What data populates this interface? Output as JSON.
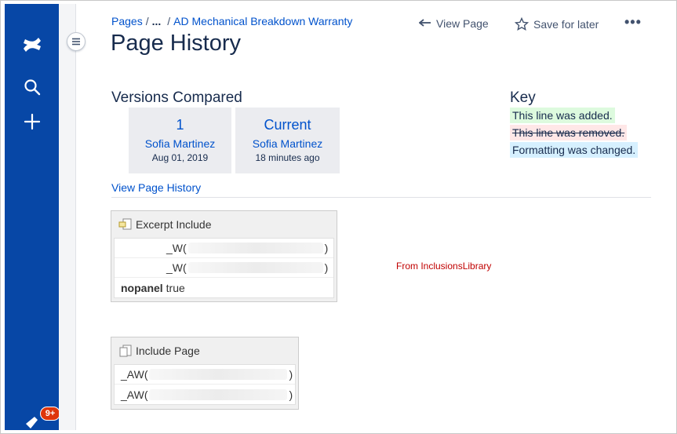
{
  "breadcrumb": {
    "pages": "Pages",
    "ellipsis": "...",
    "current": "AD Mechanical Breakdown Warranty"
  },
  "header": {
    "title": "Page History",
    "view_page": "View Page",
    "save_for_later": "Save for later",
    "more": "•••"
  },
  "sidebar": {
    "notification_badge": "9+"
  },
  "versions": {
    "heading": "Versions Compared",
    "left": {
      "number": "1",
      "author": "Sofia Martinez",
      "date": "Aug 01, 2019"
    },
    "right": {
      "number": "Current",
      "author": "Sofia Martinez",
      "date": "18 minutes ago"
    },
    "history_link": "View Page History"
  },
  "key": {
    "heading": "Key",
    "added": "This line was added.",
    "removed": "This line was removed.",
    "formatting": "Formatting was changed."
  },
  "excerpt_macro": {
    "title": "Excerpt Include",
    "rows": [
      {
        "prefix": "_W(",
        "suffix": ")"
      },
      {
        "prefix": "_W(",
        "suffix": ")"
      }
    ],
    "param_name": "nopanel",
    "param_value": "true"
  },
  "from_library": "From InclusionsLibrary",
  "include_macro": {
    "title": "Include Page",
    "rows": [
      {
        "prefix": "_AW(",
        "suffix": ")"
      },
      {
        "prefix": "_AW(",
        "suffix": ")"
      }
    ]
  },
  "colors": {
    "nav": "#0747a6",
    "link": "#0052cc",
    "added": "#ddfade",
    "removed": "#ffe7e7",
    "formatting": "#d6f0ff",
    "badge": "#de350b"
  }
}
